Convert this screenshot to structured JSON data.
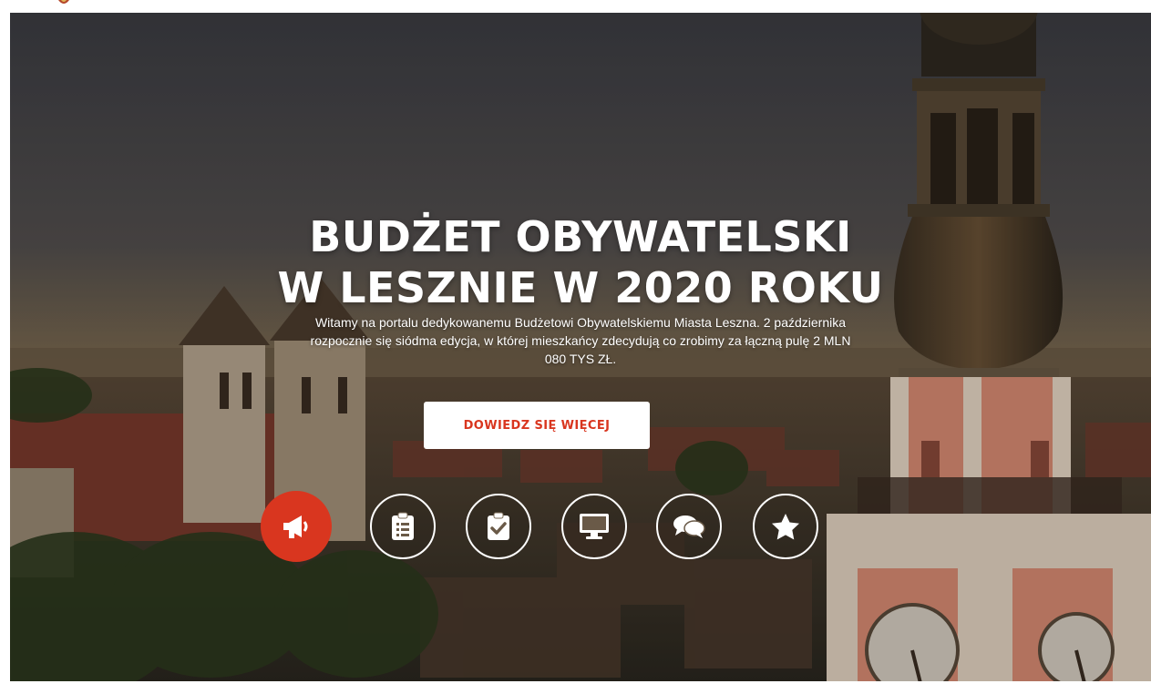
{
  "hero": {
    "title_line1": "BUDŻET OBYWATELSKI",
    "title_line2": "W LESZNIE W 2020 ROKU",
    "intro": "Witamy na portalu dedykowanemu Budżetowi Obywatelskiemu Miasta Leszna. 2 października rozpocznie się siódma edycja, w której mieszkańcy zdecydują co zrobimy za łączną pulę 2 MLN 080 TYS ZŁ.",
    "cta_label": "DOWIEDZ SIĘ WIĘCEJ"
  },
  "nav_icons": [
    {
      "name": "megaphone-icon",
      "active": true
    },
    {
      "name": "clipboard-list-icon",
      "active": false
    },
    {
      "name": "clipboard-check-icon",
      "active": false
    },
    {
      "name": "monitor-icon",
      "active": false
    },
    {
      "name": "chat-bubbles-icon",
      "active": false
    },
    {
      "name": "star-icon",
      "active": false
    }
  ],
  "colors": {
    "accent": "#d9361f",
    "button_bg": "#ffffff"
  }
}
